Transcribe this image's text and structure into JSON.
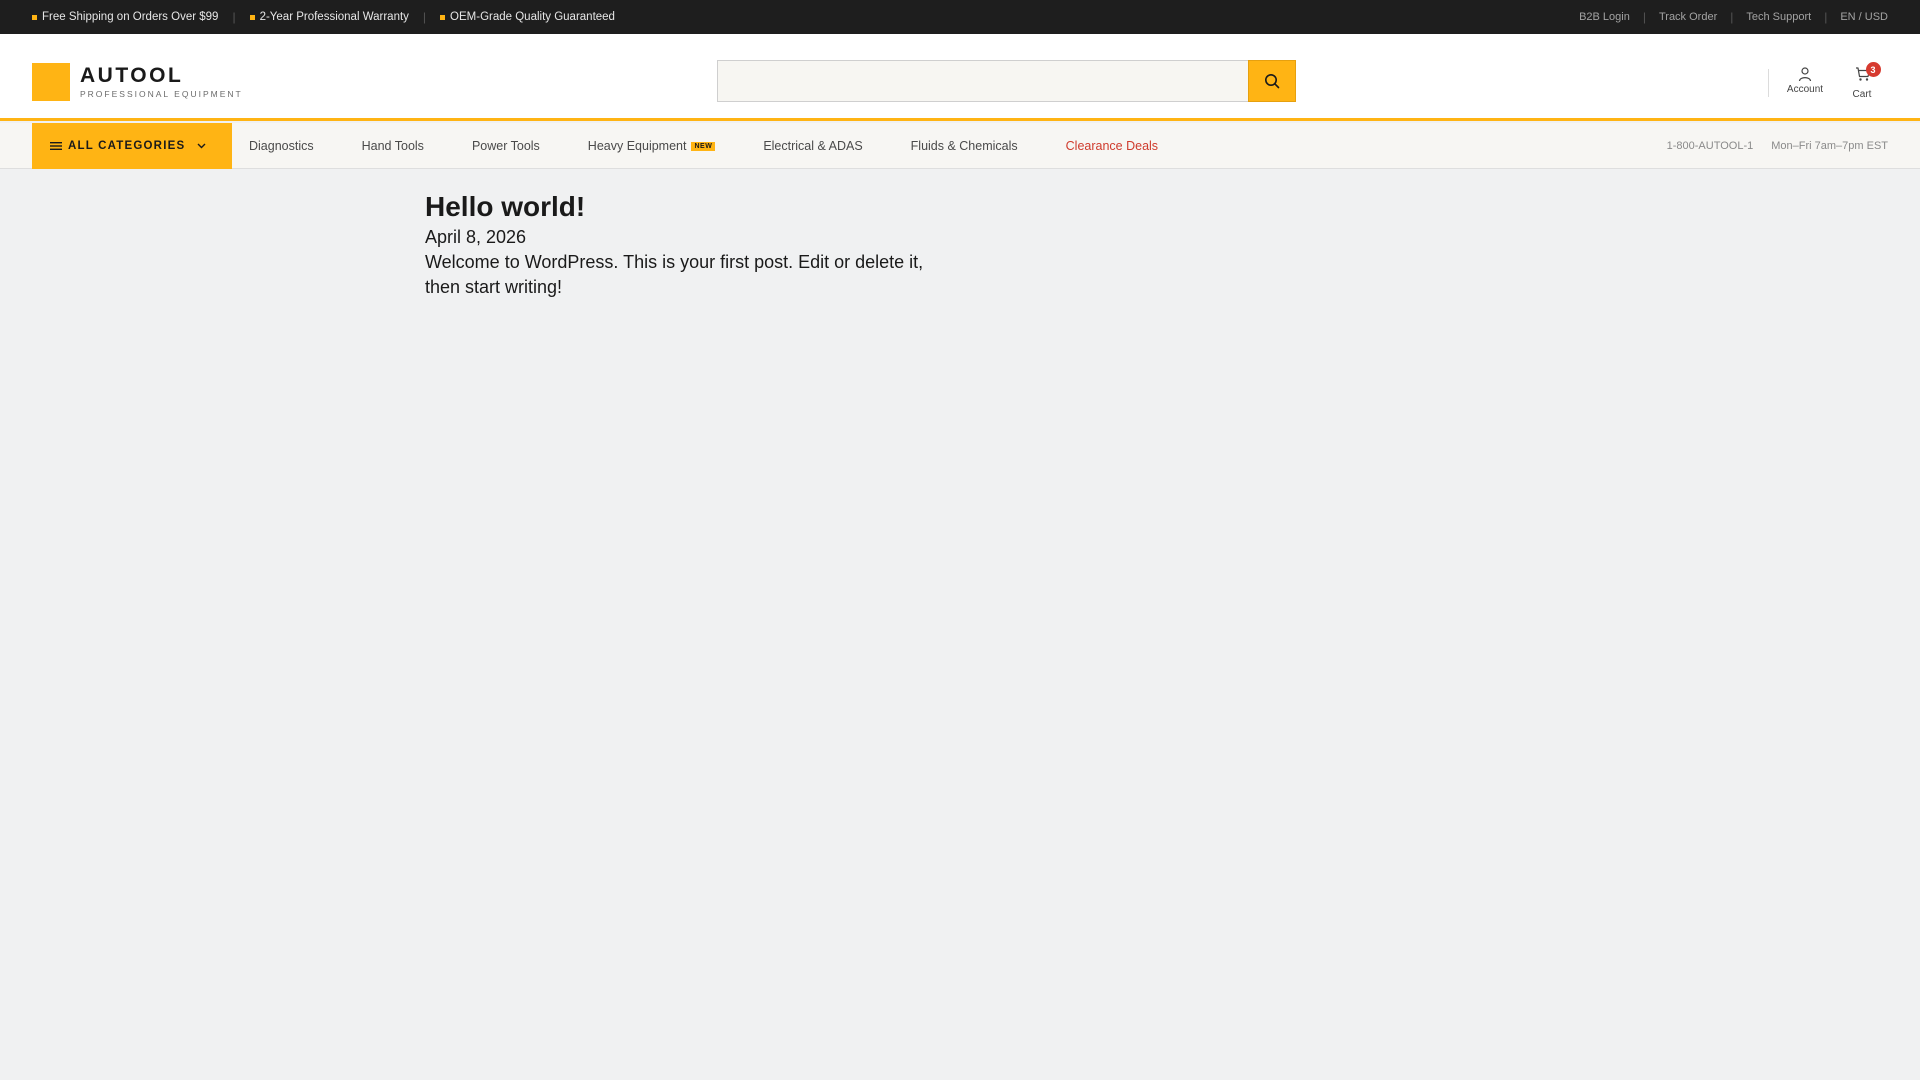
{
  "topbar": {
    "promos": [
      "Free Shipping on Orders Over $99",
      "2-Year Professional Warranty",
      "OEM-Grade Quality Guaranteed"
    ],
    "links": [
      "B2B Login",
      "Track Order",
      "Tech Support",
      "EN / USD"
    ],
    "accent_color": "#ffb414"
  },
  "header": {
    "logo_name": "AUTOOL",
    "logo_tagline": "PROFESSIONAL EQUIPMENT",
    "search_placeholder": "",
    "search_icon": "search-icon",
    "account_label": "Account",
    "cart_label": "Cart",
    "cart_count": "3"
  },
  "nav": {
    "all_categories": "ALL CATEGORIES",
    "links": [
      {
        "label": "Diagnostics"
      },
      {
        "label": "Hand Tools"
      },
      {
        "label": "Power Tools"
      },
      {
        "label": "Heavy Equipment",
        "badge": "NEW"
      },
      {
        "label": "Electrical & ADAS"
      },
      {
        "label": "Fluids & Chemicals"
      },
      {
        "label": "Clearance Deals"
      }
    ],
    "phone": "1-800-AUTOOL-1",
    "hours": "Mon–Fri 7am–7pm EST",
    "deal_color": "#cf3b2d"
  },
  "post": {
    "title": "Hello world!",
    "date": "April 8, 2026",
    "body": "Welcome to WordPress. This is your first post. Edit or delete it, then start writing!"
  }
}
